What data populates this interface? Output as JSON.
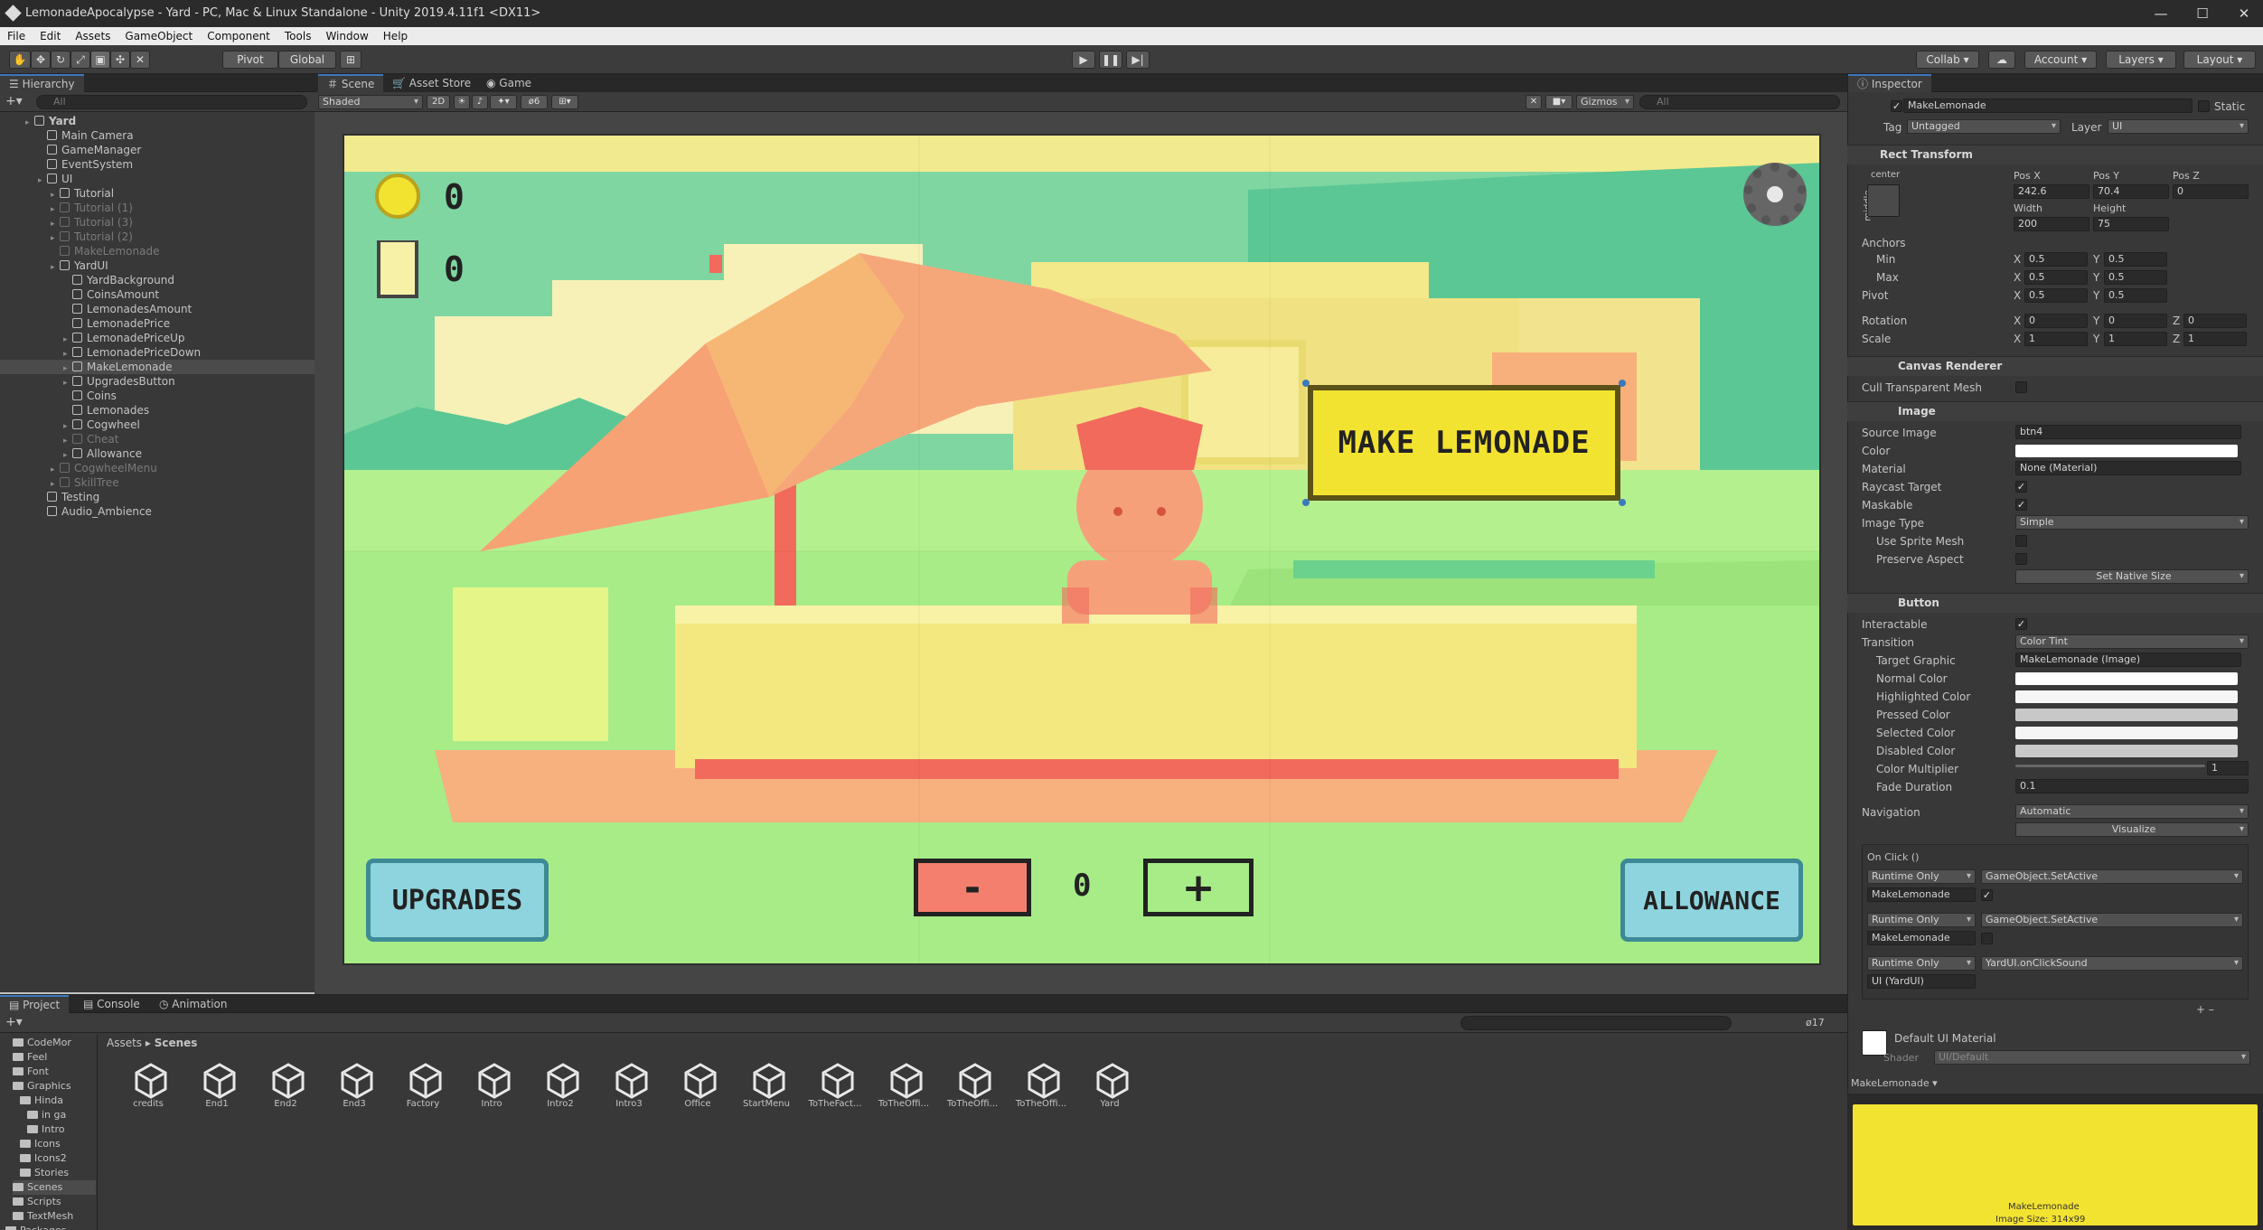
{
  "window": {
    "title": "LemonadeApocalypse - Yard - PC, Mac & Linux Standalone - Unity 2019.4.11f1 <DX11>"
  },
  "menu": [
    "File",
    "Edit",
    "Assets",
    "GameObject",
    "Component",
    "Tools",
    "Window",
    "Help"
  ],
  "toolbar": {
    "pivot": "Pivot",
    "global": "Global",
    "collab": "Collab ▾",
    "account": "Account",
    "layers": "Layers",
    "layout": "Layout"
  },
  "hierarchy": {
    "tab": "Hierarchy",
    "search_placeholder": "All",
    "items": [
      {
        "label": "Yard"
      },
      {
        "label": "Main Camera"
      },
      {
        "label": "GameManager"
      },
      {
        "label": "EventSystem"
      },
      {
        "label": "UI"
      },
      {
        "label": "Tutorial"
      },
      {
        "label": "Tutorial (1)"
      },
      {
        "label": "Tutorial (3)"
      },
      {
        "label": "Tutorial (2)"
      },
      {
        "label": "MakeLemonade"
      },
      {
        "label": "YardUI"
      },
      {
        "label": "YardBackground"
      },
      {
        "label": "CoinsAmount"
      },
      {
        "label": "LemonadesAmount"
      },
      {
        "label": "LemonadePrice"
      },
      {
        "label": "LemonadePriceUp"
      },
      {
        "label": "LemonadePriceDown"
      },
      {
        "label": "MakeLemonade"
      },
      {
        "label": "UpgradesButton"
      },
      {
        "label": "Coins"
      },
      {
        "label": "Lemonades"
      },
      {
        "label": "Cogwheel"
      },
      {
        "label": "Cheat"
      },
      {
        "label": "Allowance"
      },
      {
        "label": "CogwheelMenu"
      },
      {
        "label": "SkillTree"
      },
      {
        "label": "Testing"
      },
      {
        "label": "Audio_Ambience"
      }
    ]
  },
  "scene": {
    "tabs": [
      "Scene",
      "Asset Store",
      "Game"
    ],
    "shading": "Shaded",
    "mode2d": "2D",
    "gizmos": "Gizmos",
    "search_placeholder": "All",
    "hidden_count": "6",
    "game": {
      "coins": "0",
      "lemonades": "0",
      "make_lemonade": "MAKE LEMONADE",
      "upgrades": "UPGRADES",
      "minus": "-",
      "price": "0",
      "plus": "+",
      "allowance": "ALLOWANCE"
    }
  },
  "inspector": {
    "tab": "Inspector",
    "object_name": "MakeLemonade",
    "static": "Static",
    "tag_label": "Tag",
    "tag": "Untagged",
    "layer_label": "Layer",
    "layer": "UI",
    "rect": {
      "title": "Rect Transform",
      "anchor_h": "center",
      "anchor_v": "middle",
      "posx_l": "Pos X",
      "posy_l": "Pos Y",
      "posz_l": "Pos Z",
      "posx": "242.6",
      "posy": "70.4",
      "posz": "0",
      "w_l": "Width",
      "h_l": "Height",
      "w": "200",
      "h": "75",
      "anchors": "Anchors",
      "min": "Min",
      "max": "Max",
      "pivot": "Pivot",
      "rotation": "Rotation",
      "scale": "Scale",
      "min_x": "0.5",
      "min_y": "0.5",
      "max_x": "0.5",
      "max_y": "0.5",
      "pivot_x": "0.5",
      "pivot_y": "0.5",
      "rot_x": "0",
      "rot_y": "0",
      "rot_z": "0",
      "scale_x": "1",
      "scale_y": "1",
      "scale_z": "1",
      "x": "X",
      "y": "Y",
      "z": "Z"
    },
    "canvas": {
      "title": "Canvas Renderer",
      "cull": "Cull Transparent Mesh"
    },
    "image": {
      "title": "Image",
      "source_l": "Source Image",
      "source": "btn4",
      "color_l": "Color",
      "material_l": "Material",
      "material": "None (Material)",
      "raycast": "Raycast Target",
      "maskable": "Maskable",
      "type_l": "Image Type",
      "type": "Simple",
      "sprite_mesh": "Use Sprite Mesh",
      "preserve": "Preserve Aspect",
      "native": "Set Native Size"
    },
    "button": {
      "title": "Button",
      "interactable": "Interactable",
      "transition_l": "Transition",
      "transition": "Color Tint",
      "target_l": "Target Graphic",
      "target": "MakeLemonade (Image)",
      "normal": "Normal Color",
      "highlighted": "Highlighted Color",
      "pressed": "Pressed Color",
      "selected": "Selected Color",
      "disabled": "Disabled Color",
      "multiplier_l": "Color Multiplier",
      "multiplier": "1",
      "fade_l": "Fade Duration",
      "fade": "0.1",
      "nav_l": "Navigation",
      "nav": "Automatic",
      "visualize": "Visualize",
      "onclick": "On Click ()",
      "events": [
        {
          "mode": "Runtime Only",
          "func": "GameObject.SetActive",
          "obj": "MakeLemonade"
        },
        {
          "mode": "Runtime Only",
          "func": "GameObject.SetActive",
          "obj": "MakeLemonade"
        },
        {
          "mode": "Runtime Only",
          "func": "YardUI.onClickSound",
          "obj": "UI (YardUI)"
        }
      ]
    },
    "material": {
      "name": "Default UI Material",
      "shader_l": "Shader",
      "shader": "UI/Default"
    },
    "preview": {
      "title": "MakeLemonade ▾",
      "caption1": "MakeLemonade",
      "caption2": "Image Size: 314x99"
    }
  },
  "project": {
    "tabs": [
      "Project",
      "Console",
      "Animation"
    ],
    "breadcrumb": [
      "Assets",
      "Scenes"
    ],
    "count": "17",
    "tree": [
      "CodeMor",
      "Feel",
      "Font",
      "Graphics",
      "Hinda",
      "in ga",
      "Intro",
      "Icons",
      "Icons2",
      "Stories",
      "Scenes",
      "Scripts",
      "TextMesh",
      "Packages"
    ],
    "assets": [
      "credits",
      "End1",
      "End2",
      "End3",
      "Factory",
      "Intro",
      "Intro2",
      "Intro3",
      "Office",
      "StartMenu",
      "ToTheFact...",
      "ToTheOffi...",
      "ToTheOffi...",
      "ToTheOffi...",
      "Yard"
    ]
  },
  "colors": {
    "accent": "#3a79bb",
    "button_yellow": "#f3e331",
    "button_blue": "#8ed4df",
    "minus_red": "#f57f6e",
    "grass": "#a5ec85"
  }
}
